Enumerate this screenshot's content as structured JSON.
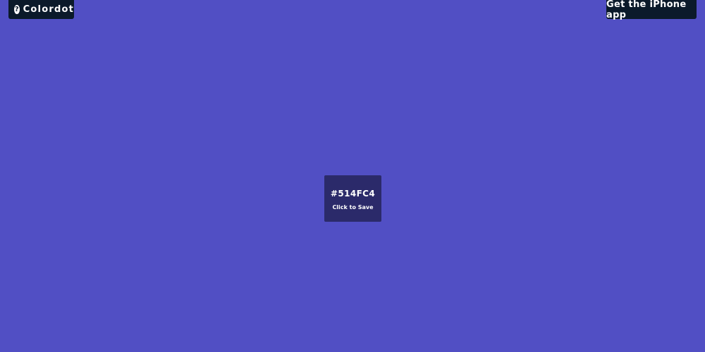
{
  "header": {
    "brand_label": "Colordot",
    "help_icon_glyph": "?",
    "app_button_label": "Get the iPhone app"
  },
  "swatch": {
    "hex_label": "#514FC4",
    "hint": "Click to Save"
  },
  "colors": {
    "background": "#514FC4",
    "swatch_card": "#2B2A6A",
    "button_bg": "#0B1A2A",
    "text": "#FFFFFF"
  },
  "icons": {
    "help": "question-circle-icon"
  }
}
